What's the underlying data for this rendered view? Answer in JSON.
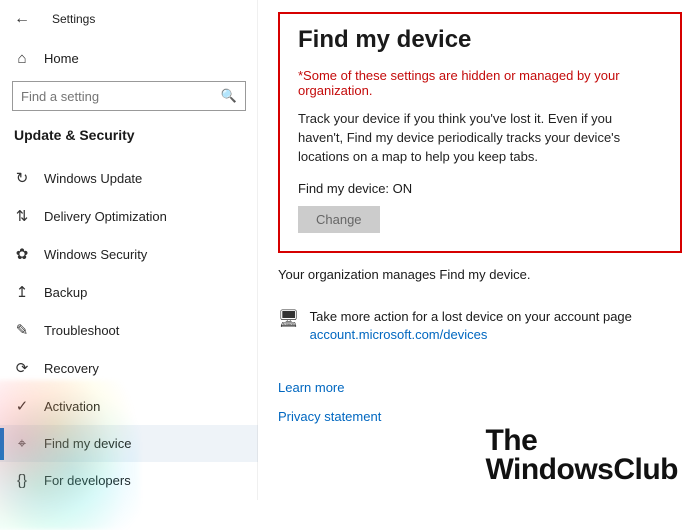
{
  "header": {
    "app_title": "Settings"
  },
  "sidebar": {
    "home_label": "Home",
    "search_placeholder": "Find a setting",
    "section_title": "Update & Security",
    "items": [
      {
        "label": "Windows Update",
        "icon": "↻",
        "name": "sidebar-item-windows-update",
        "active": false
      },
      {
        "label": "Delivery Optimization",
        "icon": "⇅",
        "name": "sidebar-item-delivery-optimization",
        "active": false
      },
      {
        "label": "Windows Security",
        "icon": "✿",
        "name": "sidebar-item-windows-security",
        "active": false
      },
      {
        "label": "Backup",
        "icon": "↥",
        "name": "sidebar-item-backup",
        "active": false
      },
      {
        "label": "Troubleshoot",
        "icon": "✎",
        "name": "sidebar-item-troubleshoot",
        "active": false
      },
      {
        "label": "Recovery",
        "icon": "⟳",
        "name": "sidebar-item-recovery",
        "active": false
      },
      {
        "label": "Activation",
        "icon": "✓",
        "name": "sidebar-item-activation",
        "active": false
      },
      {
        "label": "Find my device",
        "icon": "⌖",
        "name": "sidebar-item-find-my-device",
        "active": true
      },
      {
        "label": "For developers",
        "icon": "{}",
        "name": "sidebar-item-for-developers",
        "active": false
      }
    ]
  },
  "main": {
    "title": "Find my device",
    "org_warning": "*Some of these settings are hidden or managed by your organization.",
    "description": "Track your device if you think you've lost it. Even if you haven't, Find my device periodically tracks your device's locations on a map to help you keep tabs.",
    "status_label": "Find my device: ON",
    "change_button": "Change",
    "org_manages": "Your organization manages Find my device.",
    "action_text": "Take more action for a lost device on your account page",
    "action_link": "account.microsoft.com/devices",
    "learn_more": "Learn more",
    "privacy": "Privacy statement"
  },
  "watermark": {
    "line1": "The",
    "line2": "WindowsClub"
  }
}
